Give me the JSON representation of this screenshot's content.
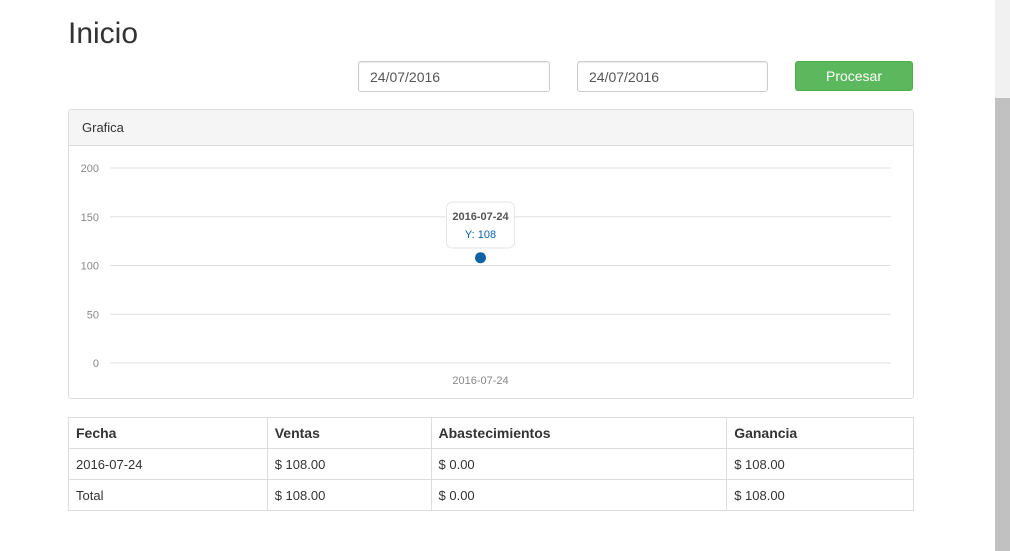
{
  "page": {
    "title": "Inicio"
  },
  "filters": {
    "date_from": "24/07/2016",
    "date_to": "24/07/2016",
    "process_label": "Procesar"
  },
  "panel": {
    "heading": "Grafica"
  },
  "chart_data": {
    "type": "line",
    "x": [
      "2016-07-24"
    ],
    "series": [
      {
        "values": [
          108
        ]
      }
    ],
    "y_ticks": [
      0,
      50,
      100,
      150,
      200
    ],
    "ylim": [
      0,
      200
    ],
    "grid": true,
    "tooltip": {
      "title": "2016-07-24",
      "label": "Y: 108"
    },
    "colors": {
      "point": "#0b62a4",
      "grid": "#e0e0e0"
    }
  },
  "table": {
    "headers": [
      "Fecha",
      "Ventas",
      "Abastecimientos",
      "Ganancia"
    ],
    "rows": [
      [
        "2016-07-24",
        "$ 108.00",
        "$ 0.00",
        "$ 108.00"
      ],
      [
        "Total",
        "$ 108.00",
        "$ 0.00",
        "$ 108.00"
      ]
    ]
  }
}
